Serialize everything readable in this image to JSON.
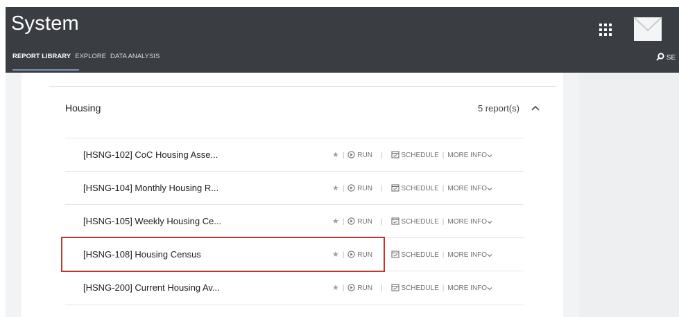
{
  "header": {
    "title": "System",
    "nav": [
      "REPORT LIBRARY",
      "EXPLORE",
      "DATA ANALYSIS"
    ],
    "search_label": "SE"
  },
  "section": {
    "title": "Housing",
    "count": "5 report(s)"
  },
  "reports": [
    {
      "name": "[HSNG-102] CoC Housing Asse..."
    },
    {
      "name": "[HSNG-104] Monthly Housing R..."
    },
    {
      "name": "[HSNG-105] Weekly Housing Ce..."
    },
    {
      "name": "[HSNG-108] Housing Census"
    },
    {
      "name": "[HSNG-200] Current Housing Av..."
    }
  ],
  "actions": {
    "star": "★",
    "run": "RUN",
    "schedule": "SCHEDULE",
    "more_info": "MORE INFO"
  },
  "colors": {
    "topbar": "#3a3d42",
    "highlight": "#c0392b"
  }
}
